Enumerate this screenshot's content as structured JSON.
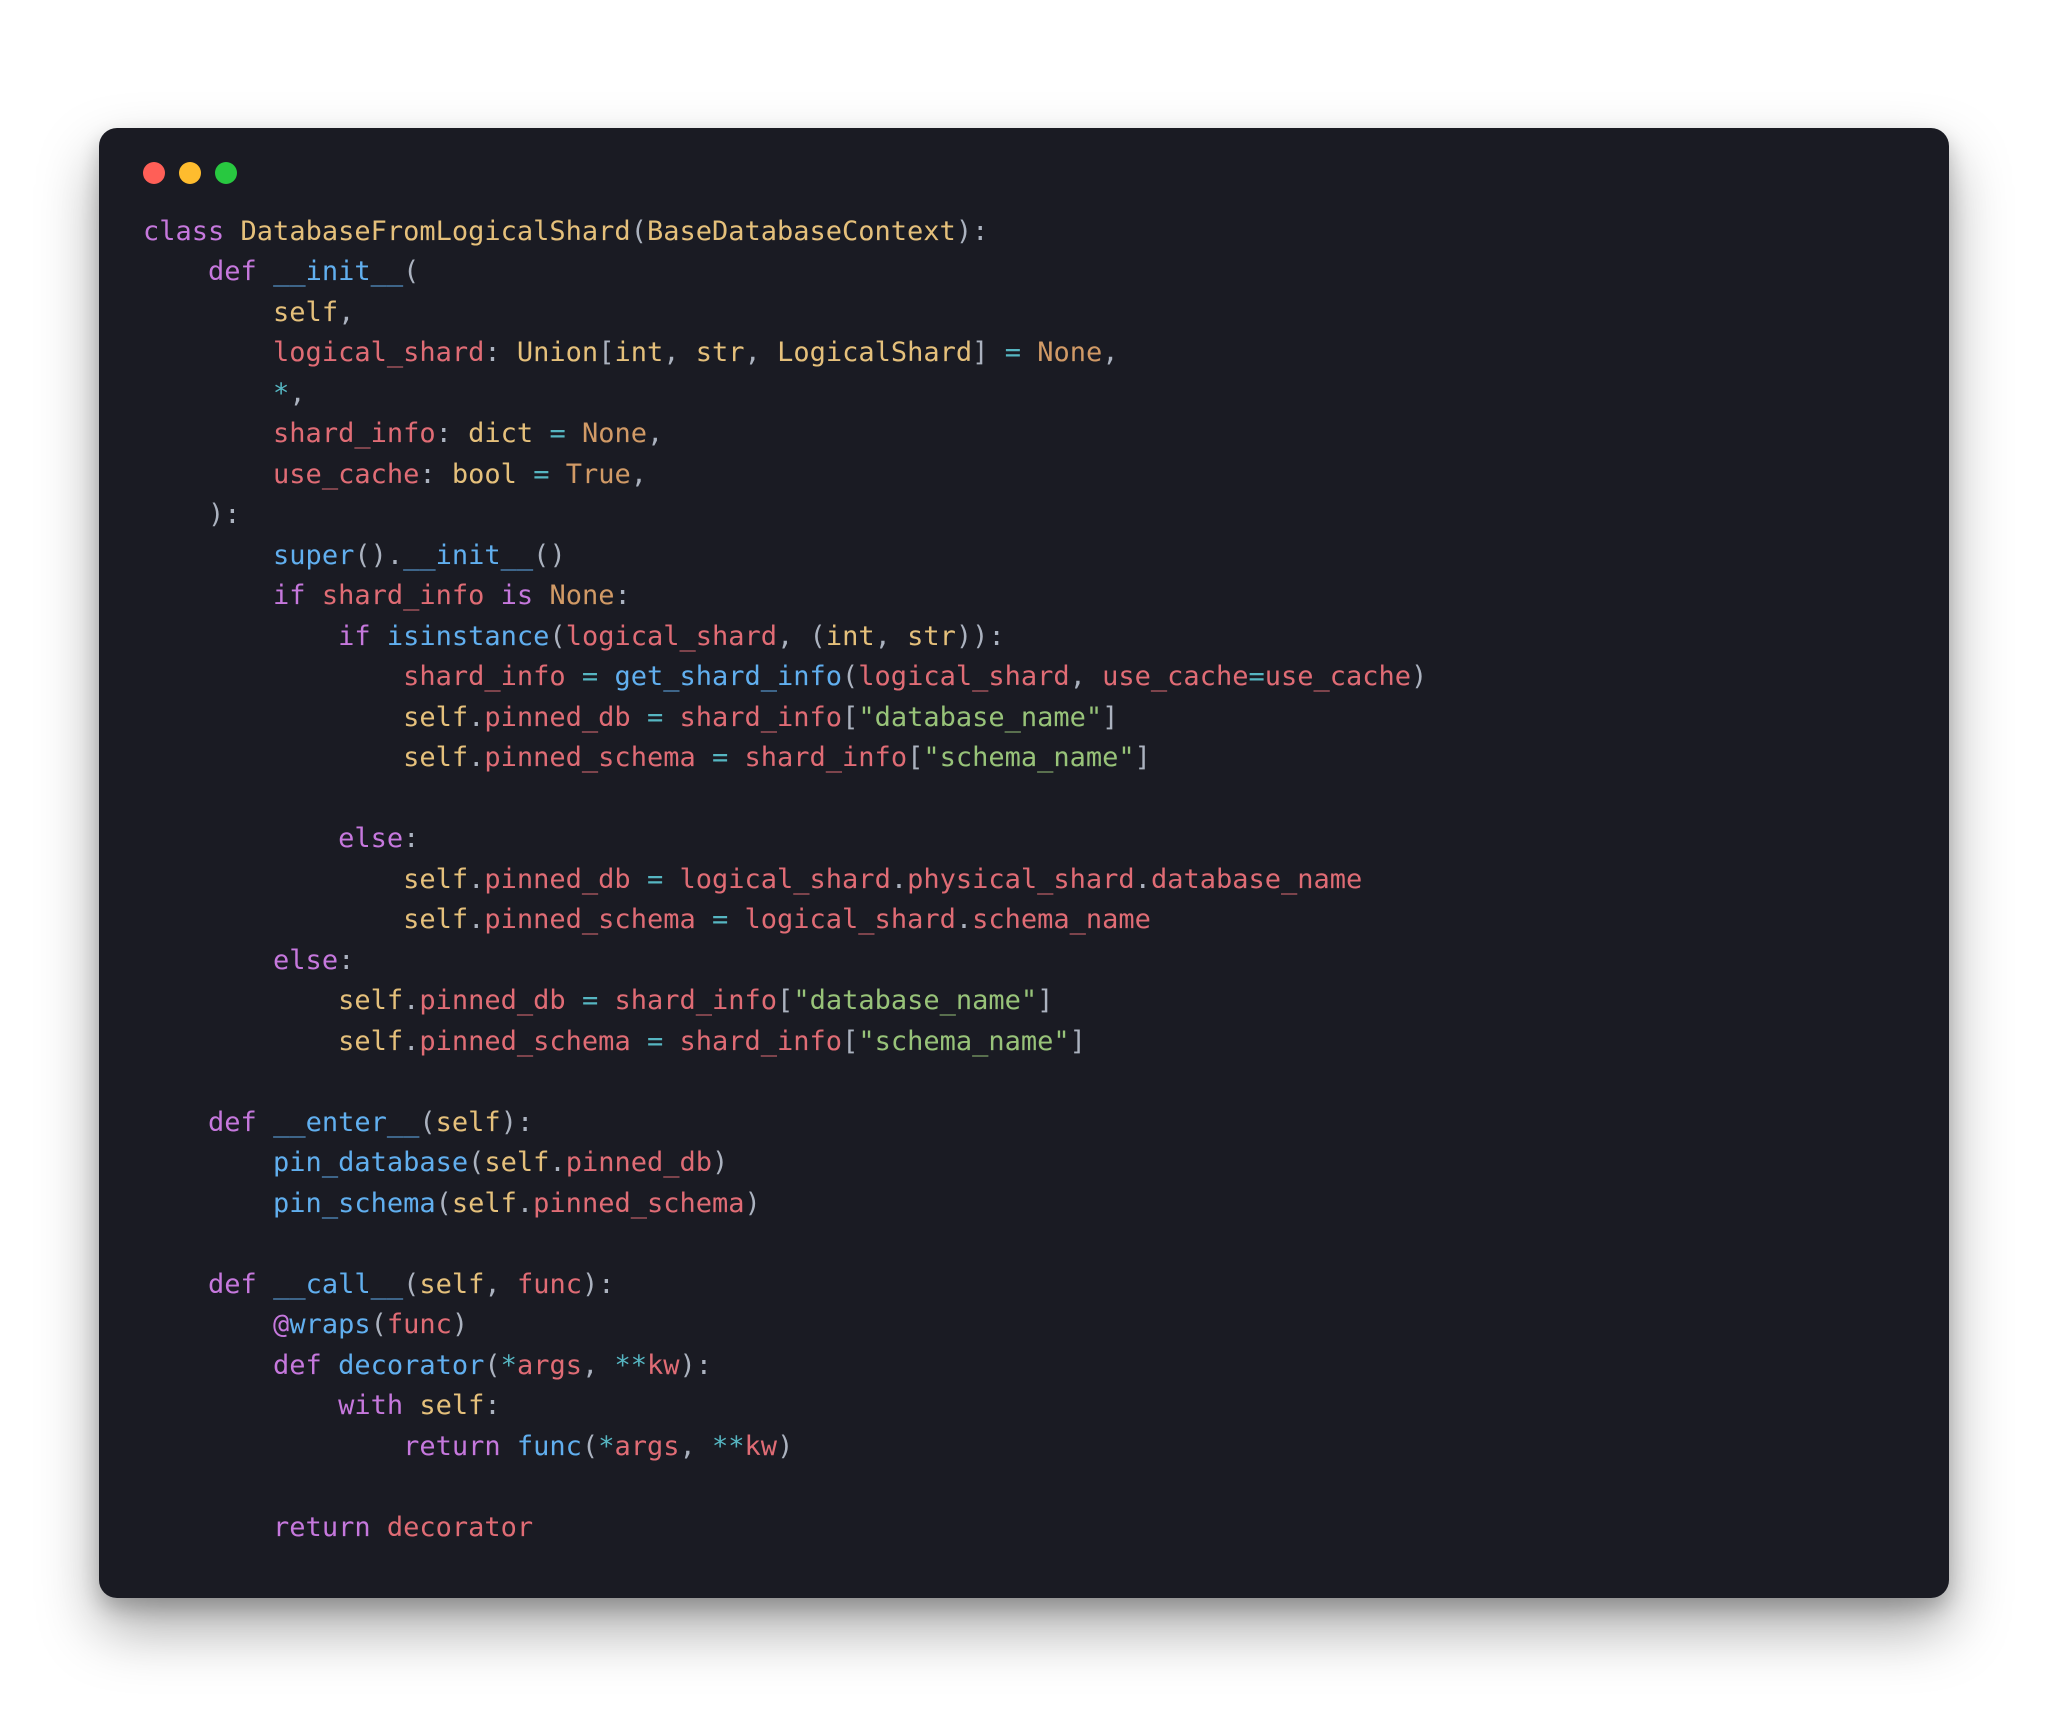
{
  "tokens": {
    "kw_class": "class",
    "kw_def": "def",
    "kw_if": "if",
    "kw_else": "else",
    "kw_is": "is",
    "kw_return": "return",
    "kw_with": "with",
    "class_name": "DatabaseFromLogicalShard",
    "base_class": "BaseDatabaseContext",
    "fn_init": "__init__",
    "fn_enter": "__enter__",
    "fn_call": "__call__",
    "fn_decorator": "decorator",
    "param_self": "self",
    "param_logical_shard": "logical_shard",
    "param_shard_info": "shard_info",
    "param_use_cache": "use_cache",
    "param_func": "func",
    "param_args": "args",
    "param_kw": "kw",
    "type_union": "Union",
    "type_int": "int",
    "type_str": "str",
    "type_logical_shard": "LogicalShard",
    "type_dict": "dict",
    "type_bool": "bool",
    "const_none": "None",
    "const_true": "True",
    "call_super": "super",
    "call_isinstance": "isinstance",
    "call_get_shard_info": "get_shard_info",
    "call_pin_database": "pin_database",
    "call_pin_schema": "pin_schema",
    "call_wraps": "wraps",
    "attr_pinned_db": "pinned_db",
    "attr_pinned_schema": "pinned_schema",
    "attr_physical_shard": "physical_shard",
    "attr_database_name": "database_name",
    "attr_schema_name": "schema_name",
    "str_database_name": "\"database_name\"",
    "str_schema_name": "\"schema_name\"",
    "op_eq": "=",
    "op_star": "*",
    "op_dstar": "**",
    "op_at": "@",
    "p_open": "(",
    "p_close": ")",
    "b_open": "[",
    "b_close": "]",
    "comma": ",",
    "colon": ":",
    "dot": "."
  }
}
